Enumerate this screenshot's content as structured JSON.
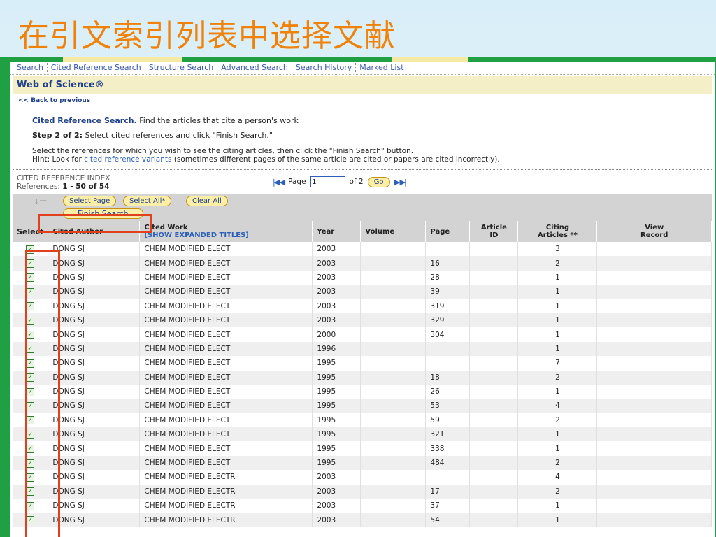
{
  "slide_title": "在引文索引列表中选择文献",
  "nav": [
    "Search",
    "Cited Reference Search",
    "Structure Search",
    "Advanced Search",
    "Search History",
    "Marked List"
  ],
  "header": {
    "product": "Web of Science®",
    "back": "<< Back to previous"
  },
  "intro": {
    "heading": "Cited Reference Search.",
    "heading_desc": " Find the articles that cite a person's work",
    "step": "Step 2 of 2:",
    "step_desc": " Select cited references and click \"Finish Search.\"",
    "instruction": "Select the references for which you wish to see the citing articles, then click the \"Finish Search\" button.",
    "hint_prefix": "Hint: Look for ",
    "hint_link": "cited reference variants",
    "hint_suffix": " (sometimes different pages of the same article are cited or papers are cited incorrectly)."
  },
  "index": {
    "label": "CITED REFERENCE INDEX",
    "refs_label": "References:",
    "refs_range": "1 - 50 of 54"
  },
  "pager": {
    "page_label": "Page",
    "page_value": "1",
    "of_label": "of 2",
    "go": "Go"
  },
  "buttons": {
    "select_page": "Select Page",
    "select_all": "Select All*",
    "clear_all": "Clear All",
    "finish_search": "Finish Search"
  },
  "columns": {
    "select": "Select",
    "author": "Cited Author",
    "work": "Cited Work",
    "show_expanded": "[SHOW EXPANDED TITLES]",
    "year": "Year",
    "volume": "Volume",
    "page": "Page",
    "article_l1": "Article",
    "article_l2": "ID",
    "citing_l1": "Citing",
    "citing_l2": "Articles **",
    "view_l1": "View",
    "view_l2": "Record"
  },
  "rows": [
    {
      "author": "DONG SJ",
      "work": "CHEM MODIFIED ELECT",
      "year": "2003",
      "volume": "",
      "page": "",
      "article": "",
      "citing": "3"
    },
    {
      "author": "DONG SJ",
      "work": "CHEM MODIFIED ELECT",
      "year": "2003",
      "volume": "",
      "page": "16",
      "article": "",
      "citing": "2"
    },
    {
      "author": "DONG SJ",
      "work": "CHEM MODIFIED ELECT",
      "year": "2003",
      "volume": "",
      "page": "28",
      "article": "",
      "citing": "1"
    },
    {
      "author": "DONG SJ",
      "work": "CHEM MODIFIED ELECT",
      "year": "2003",
      "volume": "",
      "page": "39",
      "article": "",
      "citing": "1"
    },
    {
      "author": "DONG SJ",
      "work": "CHEM MODIFIED ELECT",
      "year": "2003",
      "volume": "",
      "page": "319",
      "article": "",
      "citing": "1"
    },
    {
      "author": "DONG SJ",
      "work": "CHEM MODIFIED ELECT",
      "year": "2003",
      "volume": "",
      "page": "329",
      "article": "",
      "citing": "1"
    },
    {
      "author": "DONG SJ",
      "work": "CHEM MODIFIED ELECT",
      "year": "2000",
      "volume": "",
      "page": "304",
      "article": "",
      "citing": "1"
    },
    {
      "author": "DONG SJ",
      "work": "CHEM MODIFIED ELECT",
      "year": "1996",
      "volume": "",
      "page": "",
      "article": "",
      "citing": "1"
    },
    {
      "author": "DONG SJ",
      "work": "CHEM MODIFIED ELECT",
      "year": "1995",
      "volume": "",
      "page": "",
      "article": "",
      "citing": "7"
    },
    {
      "author": "DONG SJ",
      "work": "CHEM MODIFIED ELECT",
      "year": "1995",
      "volume": "",
      "page": "18",
      "article": "",
      "citing": "2"
    },
    {
      "author": "DONG SJ",
      "work": "CHEM MODIFIED ELECT",
      "year": "1995",
      "volume": "",
      "page": "26",
      "article": "",
      "citing": "1"
    },
    {
      "author": "DONG SJ",
      "work": "CHEM MODIFIED ELECT",
      "year": "1995",
      "volume": "",
      "page": "53",
      "article": "",
      "citing": "4"
    },
    {
      "author": "DONG SJ",
      "work": "CHEM MODIFIED ELECT",
      "year": "1995",
      "volume": "",
      "page": "59",
      "article": "",
      "citing": "2"
    },
    {
      "author": "DONG SJ",
      "work": "CHEM MODIFIED ELECT",
      "year": "1995",
      "volume": "",
      "page": "321",
      "article": "",
      "citing": "1"
    },
    {
      "author": "DONG SJ",
      "work": "CHEM MODIFIED ELECT",
      "year": "1995",
      "volume": "",
      "page": "338",
      "article": "",
      "citing": "1"
    },
    {
      "author": "DONG SJ",
      "work": "CHEM MODIFIED ELECT",
      "year": "1995",
      "volume": "",
      "page": "484",
      "article": "",
      "citing": "2"
    },
    {
      "author": "DONG SJ",
      "work": "CHEM MODIFIED ELECTR",
      "year": "2003",
      "volume": "",
      "page": "",
      "article": "",
      "citing": "4"
    },
    {
      "author": "DONG SJ",
      "work": "CHEM MODIFIED ELECTR",
      "year": "2003",
      "volume": "",
      "page": "17",
      "article": "",
      "citing": "2"
    },
    {
      "author": "DONG SJ",
      "work": "CHEM MODIFIED ELECTR",
      "year": "2003",
      "volume": "",
      "page": "37",
      "article": "",
      "citing": "1"
    },
    {
      "author": "DONG SJ",
      "work": "CHEM MODIFIED ELECTR",
      "year": "2003",
      "volume": "",
      "page": "54",
      "article": "",
      "citing": "1"
    }
  ],
  "colors": {
    "highlight": "#e0401c",
    "frame": "#1fa043",
    "title": "#f0820a",
    "link": "#2b5fb8"
  }
}
